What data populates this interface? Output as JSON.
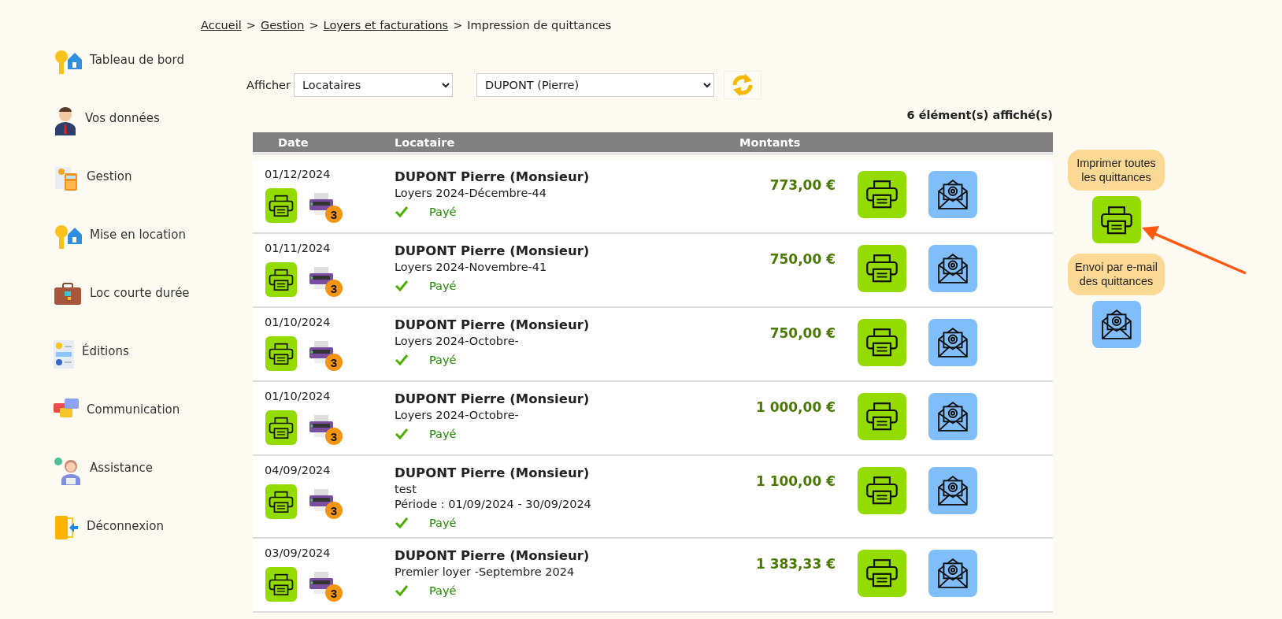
{
  "breadcrumb_separator": ">",
  "breadcrumb": [
    {
      "label": "Accueil",
      "link": true
    },
    {
      "label": "Gestion",
      "link": true
    },
    {
      "label": "Loyers et facturations",
      "link": true
    },
    {
      "label": "Impression de quittances",
      "link": false
    }
  ],
  "sidebar": {
    "items": [
      {
        "label": "Tableau de bord"
      },
      {
        "label": "Vos données"
      },
      {
        "label": "Gestion"
      },
      {
        "label": "Mise en location"
      },
      {
        "label": "Loc courte durée"
      },
      {
        "label": "Éditions"
      },
      {
        "label": "Communication"
      },
      {
        "label": "Assistance"
      },
      {
        "label": "Déconnexion"
      }
    ]
  },
  "filter": {
    "label": "Afficher",
    "type_value": "Locataires",
    "tenant_value": "DUPONT (Pierre)"
  },
  "count": "6 élément(s) affiché(s)",
  "table": {
    "columns": [
      "Date",
      "Locataire",
      "Montants"
    ],
    "rows": [
      {
        "date": "01/12/2024",
        "copies": "3",
        "tenant": "DUPONT Pierre (Monsieur)",
        "lines": [
          "Loyers 2024-Décembre-44"
        ],
        "status": "Payé",
        "amount": "773,00 €"
      },
      {
        "date": "01/11/2024",
        "copies": "3",
        "tenant": "DUPONT Pierre (Monsieur)",
        "lines": [
          "Loyers 2024-Novembre-41"
        ],
        "status": "Payé",
        "amount": "750,00 €"
      },
      {
        "date": "01/10/2024",
        "copies": "3",
        "tenant": "DUPONT Pierre (Monsieur)",
        "lines": [
          "Loyers 2024-Octobre-"
        ],
        "status": "Payé",
        "amount": "750,00 €"
      },
      {
        "date": "01/10/2024",
        "copies": "3",
        "tenant": "DUPONT Pierre (Monsieur)",
        "lines": [
          "Loyers 2024-Octobre-"
        ],
        "status": "Payé",
        "amount": "1 000,00 €"
      },
      {
        "date": "04/09/2024",
        "copies": "3",
        "tenant": "DUPONT Pierre (Monsieur)",
        "lines": [
          "test",
          "Période : 01/09/2024 - 30/09/2024"
        ],
        "status": "Payé",
        "amount": "1 100,00 €"
      },
      {
        "date": "03/09/2024",
        "copies": "3",
        "tenant": "DUPONT Pierre (Monsieur)",
        "lines": [
          "Premier loyer -Septembre 2024"
        ],
        "status": "Payé",
        "amount": "1 383,33 €"
      }
    ]
  },
  "actions": {
    "print_all": "Imprimer toutes les quittances",
    "email_all": "Envoi par e-mail des quittances"
  }
}
